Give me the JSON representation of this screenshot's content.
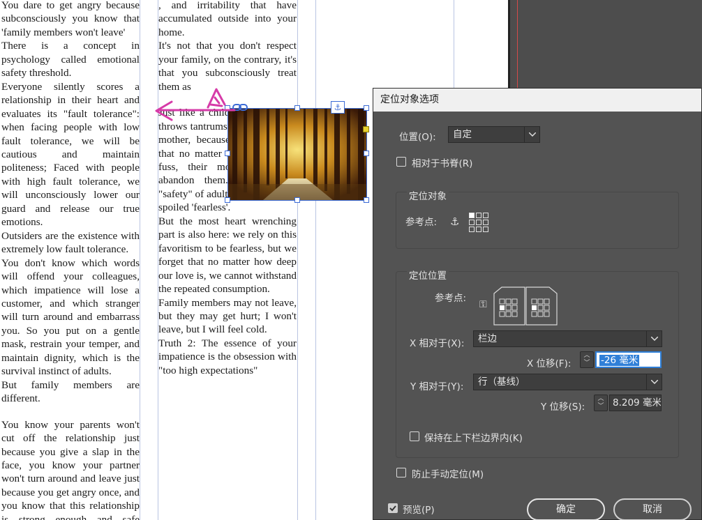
{
  "document": {
    "column1": [
      "You dare to get angry because subconsciously you know that 'family members won't leave'",
      "There is a concept in psychology called emotional safety threshold.",
      "Everyone silently scores a relationship in their heart and evaluates its \"fault tolerance\": when facing people with low fault tolerance, we will be cautious and maintain politeness; Faced with people with high fault tolerance, we will unconsciously lower our guard and release our true emotions.",
      "Outsiders are the existence with extremely low fault tolerance.",
      "You don't know which words will offend your colleagues, which impatience will lose a customer, and which stranger will turn around and embarrass you. So you put on a gentle mask, restrain your temper, and maintain dignity, which is the survival instinct of adults.",
      "But family members are different.",
      "You know your parents won't cut off the relationship just because you give a slap in the face, you know your partner won't turn around and leave just because you get angry once, and you know that this relationship is strong enough and safe enough. So you dare"
    ],
    "column2": [
      ", and irritability that have accumulated outside into your home.",
      "It's not that you don't respect your family, on the contrary, it's that you subconsciously treat them as",
      "Just like a child who cries and throws tantrums in front of their mother, because they are sure that no matter how much they fuss, their mother will not abandon them. This is the \"safety\" of adults is essentially a spoiled 'fearless'.",
      "But the most heart wrenching part is also here: we rely on this favoritism to be fearless, but we forget that no matter how deep our love is, we cannot withstand the repeated consumption.",
      "Family members may not leave, but they may get hurt; I won't leave, but I will feel cold.",
      "Truth 2: The essence of your impatience is the obsession with \"too high expectations\""
    ]
  },
  "dialog": {
    "title": "定位对象选项",
    "position_label": "位置(O):",
    "position_value": "自定",
    "relative_to_spine_label": "相对于书脊(R)",
    "anchored_object_group": "定位对象",
    "reference_point_label_1": "参考点:",
    "anchored_position_group": "定位位置",
    "reference_point_label_2": "参考点:",
    "x_relative_label": "X 相对于(X):",
    "x_relative_value": "栏边",
    "x_offset_label": "X 位移(F):",
    "x_offset_value": "-26 毫米",
    "y_relative_label": "Y 相对于(Y):",
    "y_relative_value": "行（基线）",
    "y_offset_label": "Y 位移(S):",
    "y_offset_value": "8.209 毫米",
    "keep_in_bounds_label": "保持在上下栏边界内(K)",
    "prevent_manual_label": "防止手动定位(M)",
    "preview_label": "预览(P)",
    "preview_checked": true,
    "ok_label": "确定",
    "cancel_label": "取消"
  },
  "colors": {
    "annotation": "#d63ba8",
    "selection": "#3b6bd6",
    "dialog_bg": "#535353",
    "highlight": "#2f7fd8"
  }
}
